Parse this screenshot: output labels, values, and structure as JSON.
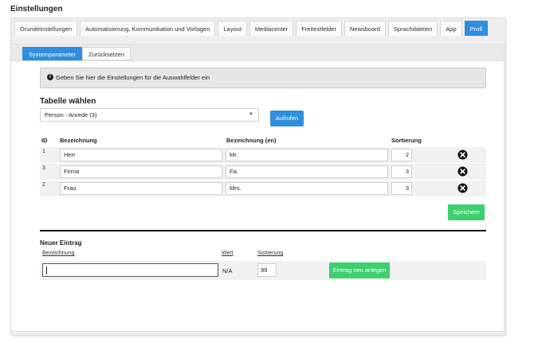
{
  "page": {
    "title": "Einstellungen"
  },
  "tabs": [
    {
      "label": "Grundeinstellungen",
      "active": false
    },
    {
      "label": "Automatisierung, Kommunikation und Vorlagen",
      "active": false
    },
    {
      "label": "Layout",
      "active": false
    },
    {
      "label": "Mediacenter",
      "active": false
    },
    {
      "label": "Freitextfelder",
      "active": false
    },
    {
      "label": "Newsboard",
      "active": false
    },
    {
      "label": "Sprachdateien",
      "active": false
    },
    {
      "label": "App",
      "active": false
    },
    {
      "label": "Profi",
      "active": true
    }
  ],
  "subtabs": [
    {
      "label": "Systemparameter",
      "active": true
    },
    {
      "label": "Zurücksetzen",
      "active": false
    }
  ],
  "info": {
    "icon": "info-circle-icon",
    "text": "Geben Sie hier die Einstellungen für die Auswahlfelder ein"
  },
  "table_select": {
    "title": "Tabelle wählen",
    "selected": "Person - Anrede (3)",
    "button_label": "Aufrufen"
  },
  "table": {
    "columns": {
      "id": "ID",
      "bezeichnung": "Bezeichnung",
      "bezeichnung_en": "Bezeichnung (en)",
      "sortierung": "Sortierung"
    },
    "rows": [
      {
        "id": "1",
        "bezeichnung": "Herr",
        "bezeichnung_en": "Mr.",
        "sortierung": "2"
      },
      {
        "id": "3",
        "bezeichnung": "Firma",
        "bezeichnung_en": "Fa.",
        "sortierung": "3"
      },
      {
        "id": "2",
        "bezeichnung": "Frau",
        "bezeichnung_en": "Mrs.",
        "sortierung": "3"
      }
    ],
    "delete_icon": "close-circle-icon",
    "save_label": "Speichern"
  },
  "new_entry": {
    "title": "Neuer Eintrag",
    "label_bezeichnung": "Bezeichnung",
    "label_wert": "Wert",
    "label_sortierung": "Sortierung",
    "bezeichnung_value": "",
    "wert_value": "N/A",
    "sortierung_value": "99",
    "button_label": "Eintrag neu anlegen"
  },
  "colors": {
    "accent_blue": "#2f8fde",
    "accent_green": "#3ecf6e",
    "panel_gray": "#eeeeee"
  }
}
